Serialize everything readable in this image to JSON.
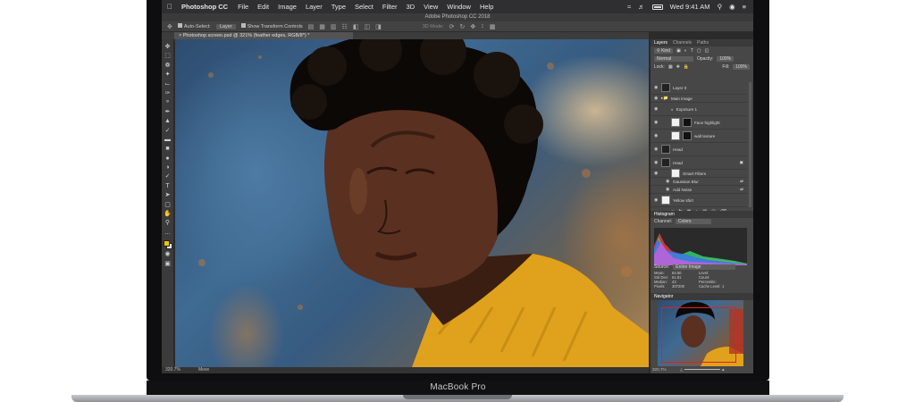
{
  "menubar": {
    "app_name": "Photoshop CC",
    "items": [
      "File",
      "Edit",
      "Image",
      "Layer",
      "Type",
      "Select",
      "Filter",
      "3D",
      "View",
      "Window",
      "Help"
    ],
    "clock": "Wed 9:41 AM",
    "icons": [
      "apple-icon",
      "wifi-icon",
      "volume-icon",
      "battery-icon",
      "search-icon",
      "user-icon",
      "menu-icon"
    ]
  },
  "window": {
    "title": "Adobe Photoshop CC 2018",
    "document_tab": "Photoshop screen.psd @ 321% (feather edges, RGB/8*) *"
  },
  "options_bar": {
    "auto_select": "Auto-Select:",
    "auto_select_value": "Layer",
    "show_transform": "Show Transform Controls",
    "mode_label": "3D Mode:"
  },
  "status_bar": {
    "zoom": "320.7%",
    "info": "Move"
  },
  "layers_panel": {
    "tabs": [
      "Layers",
      "Channels",
      "Paths"
    ],
    "filter": "Kind",
    "blend_mode": "Normal",
    "opacity_label": "Opacity:",
    "opacity": "100%",
    "lock_label": "Lock:",
    "fill_label": "Fill:",
    "fill": "100%",
    "layers": [
      {
        "name": "Layer 0",
        "thumb": "dark"
      },
      {
        "name": "Main image",
        "thumb": "folder"
      },
      {
        "name": "Exposure 1",
        "thumb": "adjust"
      },
      {
        "name": "Face highlight",
        "thumb": "mask"
      },
      {
        "name": "wall texture",
        "thumb": "mask"
      },
      {
        "name": "Head",
        "thumb": "dark"
      },
      {
        "name": "Head",
        "thumb": "dark"
      },
      {
        "name": "Smart Filters",
        "thumb": "white"
      },
      {
        "name": "Gaussian Blur",
        "thumb": "none"
      },
      {
        "name": "Add Noise",
        "thumb": "none"
      },
      {
        "name": "Yellow shirt",
        "thumb": "white"
      }
    ]
  },
  "histogram_panel": {
    "title": "Histogram",
    "channel_label": "Channel:",
    "channel": "Colors",
    "source_label": "Source:",
    "source": "Entire Image",
    "stats": [
      [
        "Mean:",
        "84.50",
        "Level:",
        ""
      ],
      [
        "Std Dev:",
        "61.81",
        "Count:",
        ""
      ],
      [
        "Median:",
        "43",
        "Percentile:",
        ""
      ],
      [
        "Pixels:",
        "307200",
        "Cache Level:",
        "1"
      ]
    ]
  },
  "navigator_panel": {
    "title": "Navigator",
    "zoom": "320.7%"
  },
  "laptop": {
    "label": "MacBook Pro"
  }
}
